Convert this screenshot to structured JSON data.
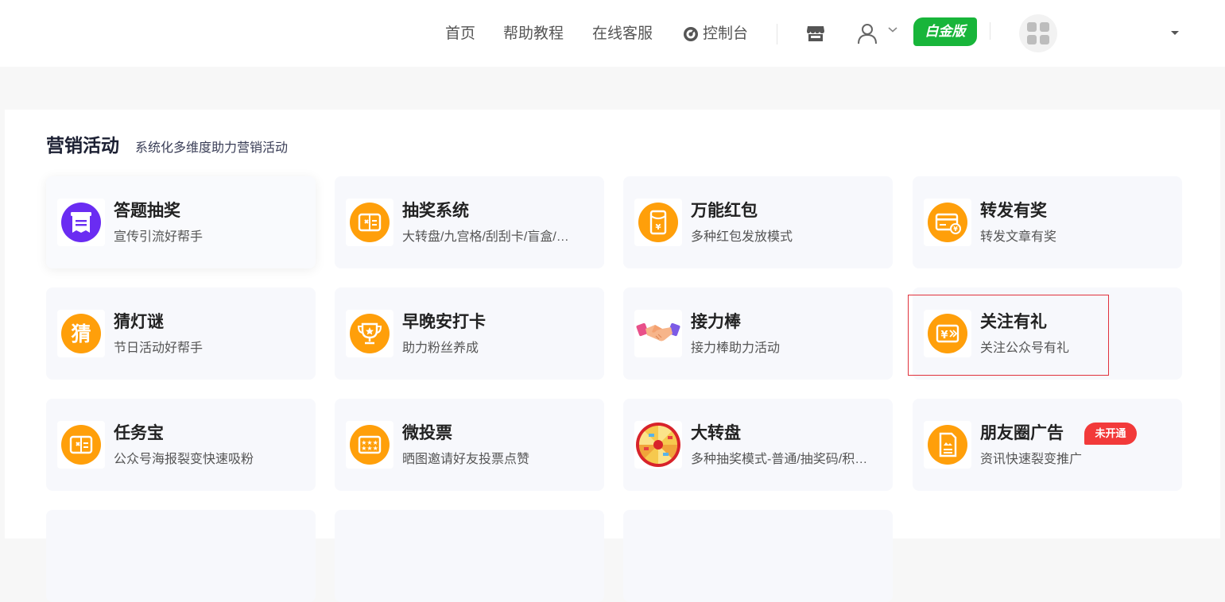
{
  "header": {
    "nav": [
      {
        "label": "首页"
      },
      {
        "label": "帮助教程"
      },
      {
        "label": "在线客服"
      },
      {
        "label": "控制台",
        "icon": "console-icon"
      }
    ],
    "plan_badge": "白金版",
    "icons": [
      "store-icon",
      "user-icon",
      "chevron-down-icon",
      "apps-icon",
      "caret-down-icon"
    ]
  },
  "section": {
    "title": "营销活动",
    "subtitle": "系统化多维度助力营销活动"
  },
  "cards": [
    {
      "title": "答题抽奖",
      "desc": "宣传引流好帮手",
      "icon": "quiz-icon"
    },
    {
      "title": "抽奖系统",
      "desc": "大转盘/九宫格/刮刮卡/盲盒/…",
      "icon": "lottery-ticket-icon"
    },
    {
      "title": "万能红包",
      "desc": "多种红包发放模式",
      "icon": "red-packet-icon"
    },
    {
      "title": "转发有奖",
      "desc": "转发文章有奖",
      "icon": "share-reward-icon"
    },
    {
      "title": "猜灯谜",
      "desc": "节日活动好帮手",
      "icon": "riddle-icon",
      "glyph": "猜"
    },
    {
      "title": "早晚安打卡",
      "desc": "助力粉丝养成",
      "icon": "trophy-icon"
    },
    {
      "title": "接力棒",
      "desc": "接力棒助力活动",
      "icon": "handshake-icon"
    },
    {
      "title": "关注有礼",
      "desc": "关注公众号有礼",
      "icon": "follow-gift-icon"
    },
    {
      "title": "任务宝",
      "desc": "公众号海报裂变快速吸粉",
      "icon": "task-ticket-icon"
    },
    {
      "title": "微投票",
      "desc": "晒图邀请好友投票点赞",
      "icon": "vote-icon"
    },
    {
      "title": "大转盘",
      "desc": "多种抽奖模式-普通/抽奖码/积…",
      "icon": "wheel-icon"
    },
    {
      "title": "朋友圈广告",
      "desc": "资讯快速裂变推广",
      "icon": "moments-ad-icon",
      "tag": "未开通"
    }
  ],
  "colors": {
    "accent_orange": "#ff9f0a",
    "quiz_purple": "#6a2cf2",
    "badge_green": "#18b53a",
    "tag_red": "#f23a3a",
    "highlight_red": "#e0323c"
  }
}
